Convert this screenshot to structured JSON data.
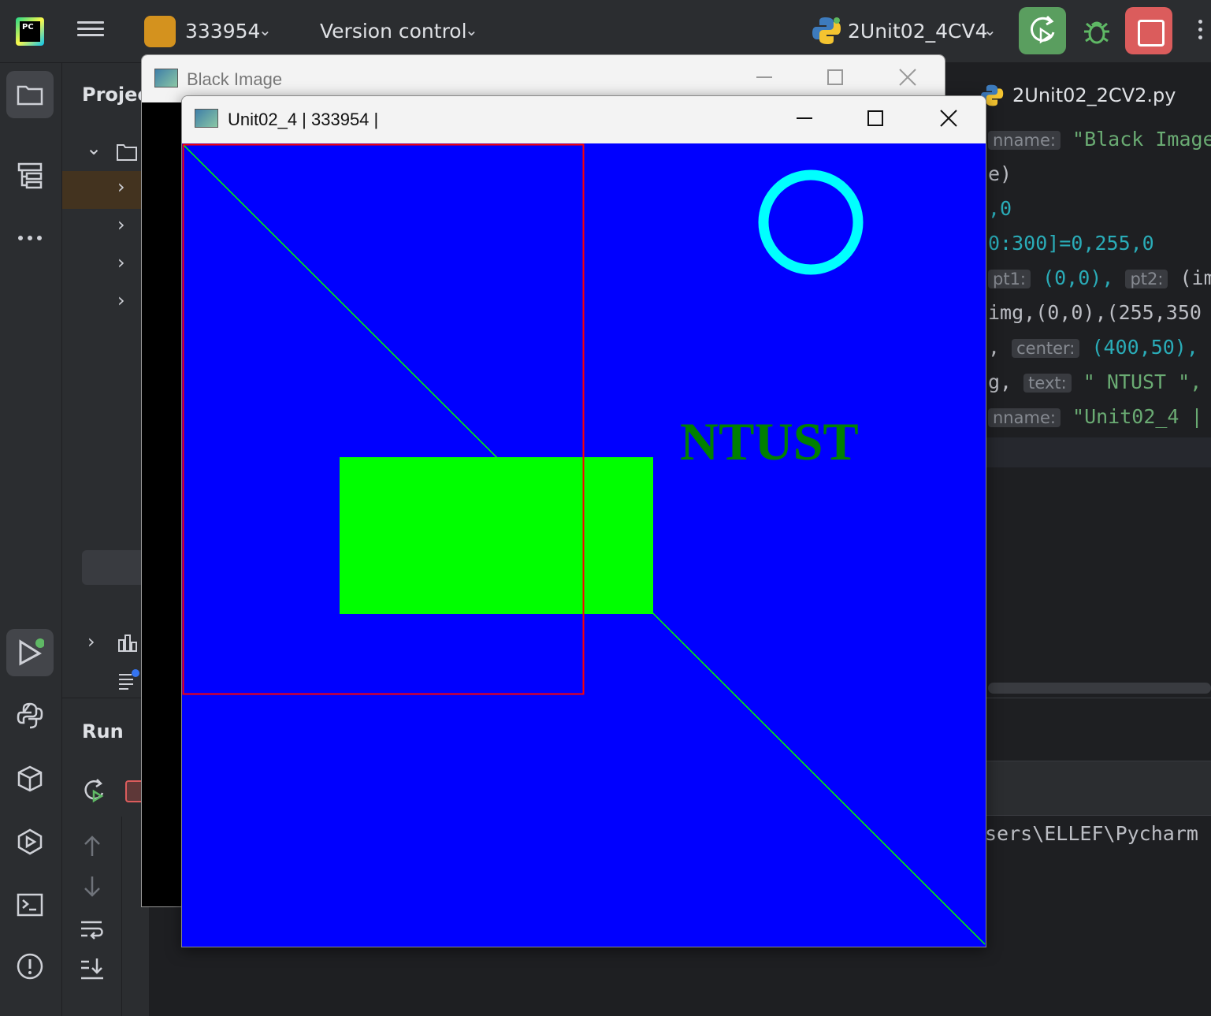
{
  "topbar": {
    "logo_text": "PC",
    "project_name": "333954",
    "version_control": "Version control",
    "run_config": "2Unit02_4CV4"
  },
  "project_panel": {
    "title": "Project"
  },
  "run_panel": {
    "title": "Run"
  },
  "editor": {
    "tab_label": "2Unit02_2CV2.py",
    "lines": [
      {
        "hint": "nname:",
        "code": "\"Black Image"
      },
      {
        "code": "e)"
      },
      {
        "code": ",0"
      },
      {
        "code": "0:300]=0,255,0"
      },
      {
        "hint": "pt1:",
        "code": "(0,0),",
        "hint2": "pt2:",
        "code2": "(img"
      },
      {
        "code": "img,(0,0),(255,350"
      },
      {
        "hint": "center:",
        "code": "(400,50),"
      },
      {
        "hint": "text:",
        "code": "\" NTUST \","
      },
      {
        "hint": "nname:",
        "code": "\"Unit02_4 |"
      }
    ]
  },
  "console": {
    "output_path": "sers\\ELLEF\\Pycharm"
  },
  "windows": {
    "black_image": {
      "title": "Black Image"
    },
    "main": {
      "title": "Unit02_4 | 333954 |"
    }
  },
  "image": {
    "background_color": "#0000ff",
    "text": "NTUST",
    "text_color": "#008000",
    "rectangle_fill": "#00ff00",
    "circle_color": "#00ffff",
    "line_color": "#00ff00",
    "outline_color": "#ff0000"
  }
}
